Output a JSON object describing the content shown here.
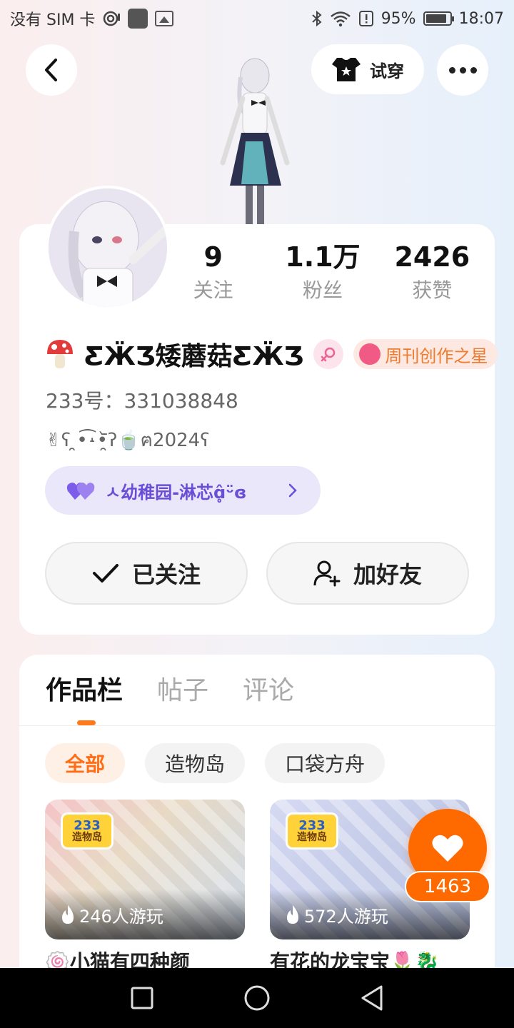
{
  "status_bar": {
    "carrier": "没有 SIM 卡",
    "battery": "95%",
    "time": "18:07"
  },
  "header": {
    "tryon_label": "试穿"
  },
  "profile": {
    "stats": [
      {
        "value": "9",
        "label": "关注"
      },
      {
        "value": "1.1万",
        "label": "粉丝"
      },
      {
        "value": "2426",
        "label": "获赞"
      }
    ],
    "name": "ƸӜƷ矮蘑菇ƸӜƷ",
    "badge_label": "周刊创作之星",
    "id_line": "233号：331038848",
    "bio": "✌ʕ ̯•͡˔•̯᷅ʔ🍵ฅ2024ʕ",
    "family": "ㅅ幼稚园-淋芯ɑ̥̂ᵕ̈ɞ",
    "follow_label": "已关注",
    "friend_label": "加好友"
  },
  "works": {
    "tabs": [
      "作品栏",
      "帖子",
      "评论"
    ],
    "filters": [
      "全部",
      "造物岛",
      "口袋方舟"
    ],
    "logo_num": "233",
    "logo_text": "造物岛",
    "games": [
      {
        "plays": "246人游玩",
        "title": "🍥小猫有四种颜"
      },
      {
        "plays": "572人游玩",
        "title": "有花的龙宝宝🌷🐉"
      }
    ]
  },
  "like": {
    "count": "1463"
  }
}
